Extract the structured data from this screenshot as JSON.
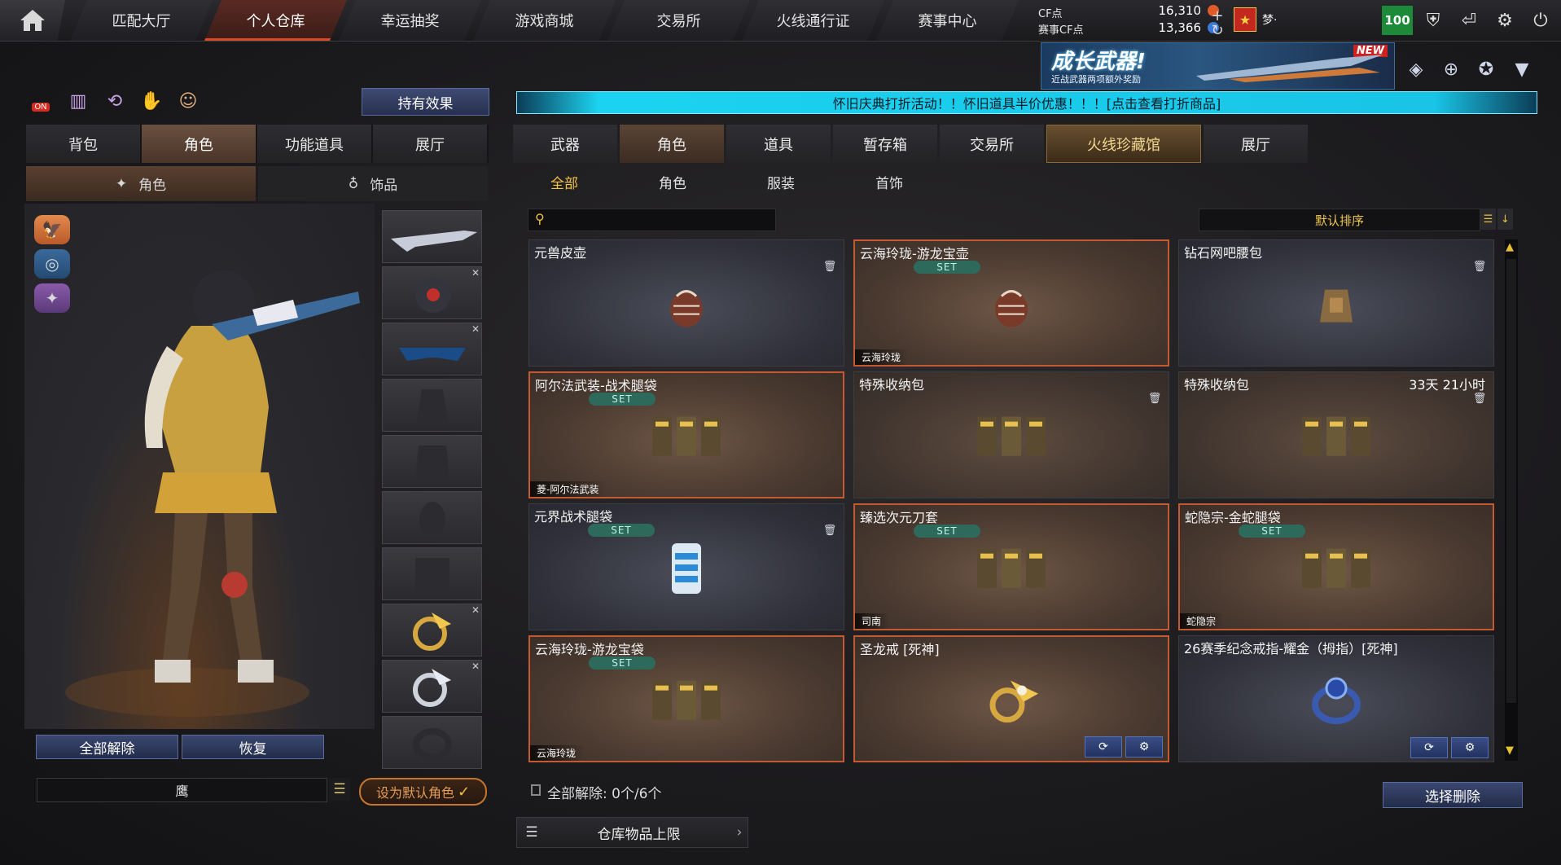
{
  "top_nav": {
    "tabs": [
      "匹配大厅",
      "个人仓库",
      "幸运抽奖",
      "游戏商城",
      "交易所",
      "火线通行证",
      "赛事中心"
    ],
    "active_index": 1
  },
  "currency": {
    "cf_label": "CF点",
    "cf_value": "16,310",
    "event_label": "赛事CF点",
    "event_value": "13,366",
    "player_name": "梦·"
  },
  "vip_level": "100",
  "promo": {
    "title": "成长武器!",
    "subtitle": "近战武器两项额外奖励",
    "badge": "NEW"
  },
  "notice": "怀旧庆典打折活动！！怀旧道具半价优惠！！！[点击查看打折商品]",
  "left_panel": {
    "quick_toggle_label": "ON",
    "effect_button": "持有效果",
    "tabs": [
      "背包",
      "角色",
      "功能道具",
      "展厅"
    ],
    "active_tab": 1,
    "subtabs": [
      "角色",
      "饰品"
    ],
    "active_subtab": 0,
    "unequip_all": "全部解除",
    "restore": "恢复",
    "character_name": "鹰",
    "set_default": "设为默认角色"
  },
  "right_panel": {
    "tabs": [
      "武器",
      "角色",
      "道具",
      "暂存箱",
      "交易所",
      "火线珍藏馆",
      "展厅"
    ],
    "active_tab": 1,
    "special_tab": 5,
    "subtabs": [
      "全部",
      "角色",
      "服装",
      "首饰"
    ],
    "active_subtab": 0,
    "search_placeholder": "",
    "sort_label": "默认排序",
    "set_badge": "SET",
    "items": [
      {
        "name": "元兽皮壶",
        "set": false,
        "tag": "",
        "extra": "",
        "style": "plain",
        "icon": "pot-icon"
      },
      {
        "name": "云海玲珑-游龙宝壶",
        "set": true,
        "tag": "云海玲珑",
        "extra": "",
        "style": "gold",
        "icon": "pot-icon"
      },
      {
        "name": "钻石网吧腰包",
        "set": false,
        "tag": "",
        "extra": "",
        "style": "plain",
        "icon": "waist-bag-icon"
      },
      {
        "name": "阿尔法武装-战术腿袋",
        "set": true,
        "tag": "菱-阿尔法武装",
        "extra": "",
        "style": "gold",
        "icon": "leg-pouch-icon"
      },
      {
        "name": "特殊收纳包",
        "set": false,
        "tag": "",
        "extra": "",
        "style": "brown",
        "icon": "leg-pouch-icon"
      },
      {
        "name": "特殊收纳包",
        "set": false,
        "tag": "",
        "extra": "33天 21小时",
        "style": "brown",
        "icon": "leg-pouch-icon"
      },
      {
        "name": "元界战术腿袋",
        "set": true,
        "tag": "",
        "extra": "",
        "style": "plain",
        "icon": "tech-pouch-icon"
      },
      {
        "name": "臻选次元刀套",
        "set": true,
        "tag": "司南",
        "extra": "",
        "style": "gold",
        "icon": "leg-pouch-icon"
      },
      {
        "name": "蛇隐宗-金蛇腿袋",
        "set": true,
        "tag": "蛇隐宗",
        "extra": "",
        "style": "gold",
        "icon": "leg-pouch-icon"
      },
      {
        "name": "云海玲珑-游龙宝袋",
        "set": true,
        "tag": "云海玲珑",
        "extra": "",
        "style": "gold",
        "icon": "leg-pouch-icon"
      },
      {
        "name": "圣龙戒 [死神]",
        "set": false,
        "tag": "",
        "extra": "",
        "style": "gold",
        "icon": "dragon-ring-icon"
      },
      {
        "name": "26赛季纪念戒指-耀金（拇指）[死神]",
        "set": false,
        "tag": "",
        "extra": "",
        "style": "plain",
        "icon": "ring-icon"
      }
    ],
    "unequip_all_count": "全部解除: 0个/6个",
    "select_delete": "选择删除",
    "storage_limit": "仓库物品上限"
  },
  "colors": {
    "accent_orange": "#c35a32",
    "notice_cyan": "#19c4e6",
    "vip_green": "#1d8a3a",
    "gold_text": "#f0c850"
  }
}
